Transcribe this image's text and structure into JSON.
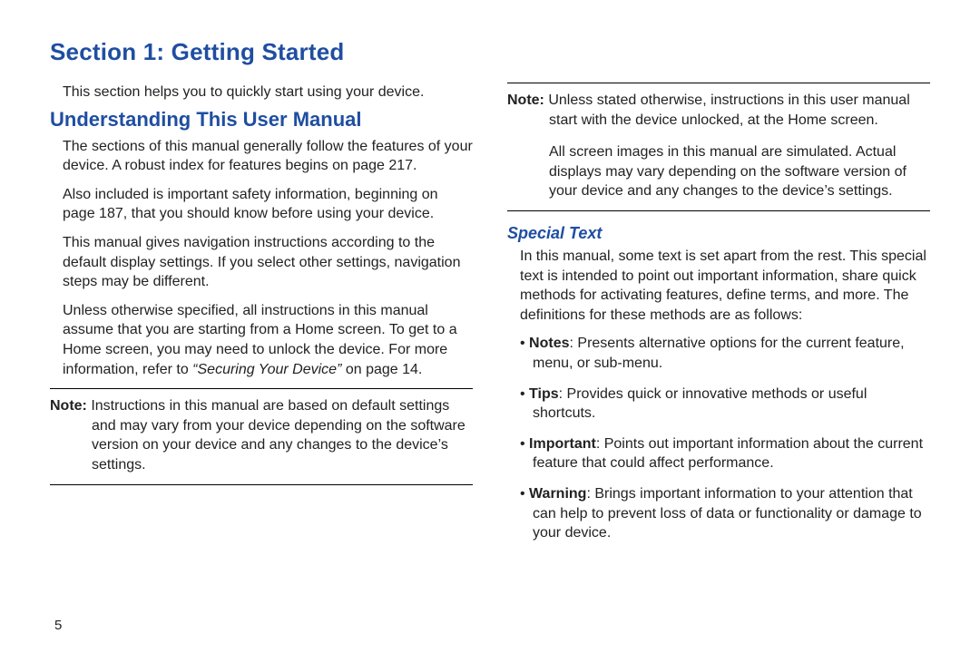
{
  "title": "Section 1: Getting Started",
  "intro": "This section helps you to quickly start using your device.",
  "h2": "Understanding This User Manual",
  "p1": "The sections of this manual generally follow the features of your device. A robust index for features begins on page 217.",
  "p2": "Also included is important safety information, beginning on page 187, that you should know before using your device.",
  "p3": "This manual gives navigation instructions according to the default display settings. If you select other settings, navigation steps may be different.",
  "p4a": "Unless otherwise specified, all instructions in this manual assume that you are starting from a Home screen. To get to a Home screen, you may need to unlock the device. For more information, refer to ",
  "p4ref": "“Securing Your Device”",
  "p4b": " on page 14.",
  "note1_label": "Note:",
  "note1_text": " Instructions in this manual are based on default settings and may vary from your device depending on the software version on your device and any changes to the device’s settings.",
  "note2_label": "Note:",
  "note2_text": " Unless stated otherwise, instructions in this user manual start with the device unlocked, at the Home screen.",
  "note2_p2": "All screen images in this manual are simulated. Actual displays may vary depending on the software version of your device and any changes to the device’s settings.",
  "h3": "Special Text",
  "special_intro": "In this manual, some text is set apart from the rest. This special text is intended to point out important information, share quick methods for activating features, define terms, and more. The definitions for these methods are as follows:",
  "defs": [
    {
      "term": "Notes",
      "text": ": Presents alternative options for the current feature, menu, or sub-menu."
    },
    {
      "term": "Tips",
      "text": ": Provides quick or innovative methods or useful shortcuts."
    },
    {
      "term": "Important",
      "text": ": Points out important information about the current feature that could affect performance."
    },
    {
      "term": "Warning",
      "text": ": Brings important information to your attention that can help to prevent loss of data or functionality or damage to your device."
    }
  ],
  "page_number": "5"
}
